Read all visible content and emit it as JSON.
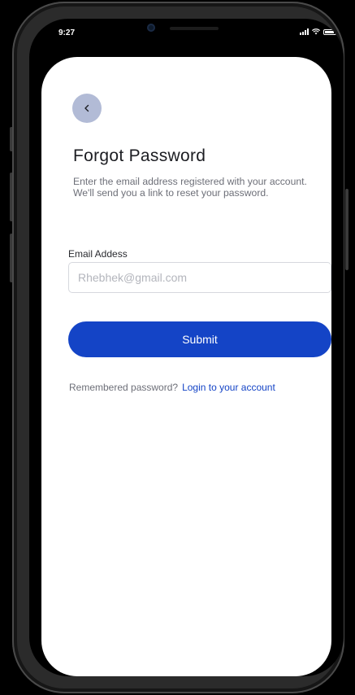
{
  "status_bar": {
    "time": "9:27"
  },
  "header": {
    "back_icon": "chevron-left-icon",
    "title": "Forgot Password",
    "subtitle_line1": "Enter the email address registered with your account.",
    "subtitle_line2": "We'll send you a link to reset your password."
  },
  "form": {
    "email_label": "Email Addess",
    "email_placeholder": "Rhebhek@gmail.com",
    "email_value": "",
    "submit_label": "Submit"
  },
  "footer": {
    "prompt": "Remembered password?",
    "login_link": "Login to your account"
  },
  "colors": {
    "primary": "#1444c6",
    "back_button_bg": "#b2bbd6",
    "title_text": "#1c1d22",
    "muted_text": "#6d6f78",
    "field_border": "#d6d8de"
  }
}
